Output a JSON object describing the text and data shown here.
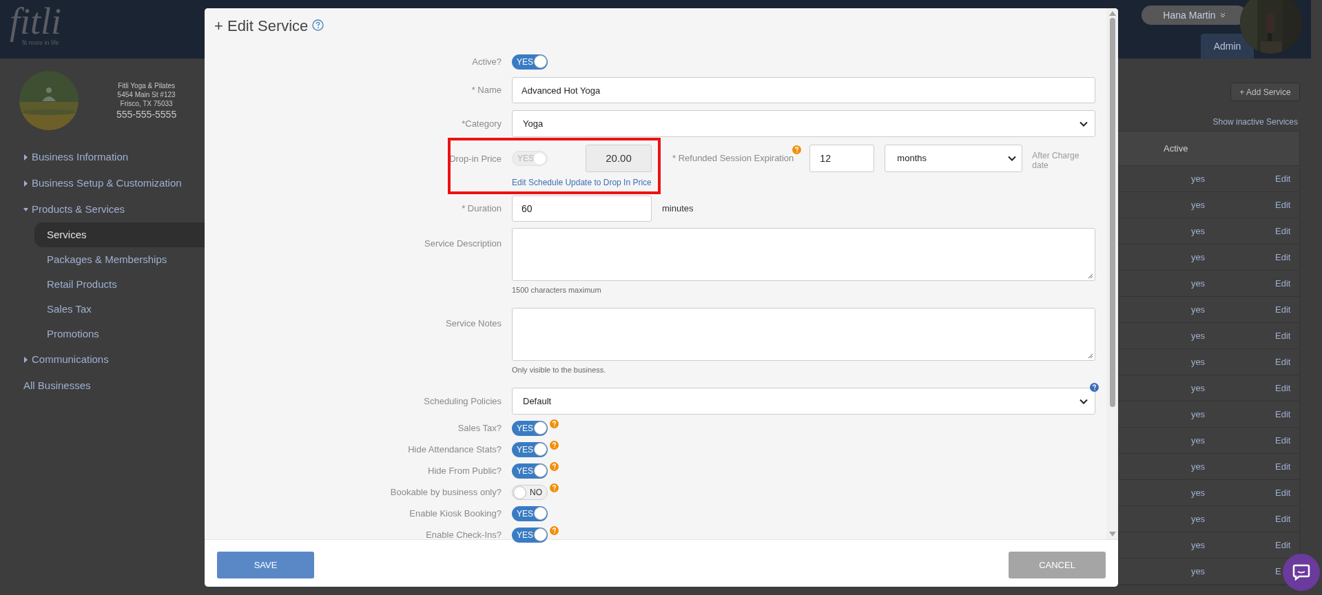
{
  "header": {
    "logo": "fitli",
    "tagline": "fit more in life",
    "user": "Hana Martin",
    "tabs": [
      {
        "label": "Admin",
        "selected": true
      }
    ]
  },
  "business": {
    "name": "Fitli Yoga & Pilates",
    "address": "5454 Main St #123",
    "city": "Frisco, TX 75033",
    "phone": "555-555-5555"
  },
  "sidebar": {
    "items": [
      {
        "kind": "group",
        "label": "Business Information",
        "expanded": false
      },
      {
        "kind": "group",
        "label": "Business Setup & Customization",
        "expanded": false
      },
      {
        "kind": "group",
        "label": "Products & Services",
        "expanded": true,
        "children": [
          {
            "label": "Services",
            "selected": true
          },
          {
            "label": "Packages & Memberships",
            "selected": false
          },
          {
            "label": "Retail Products",
            "selected": false
          },
          {
            "label": "Sales Tax",
            "selected": false
          },
          {
            "label": "Promotions",
            "selected": false
          }
        ]
      },
      {
        "kind": "group",
        "label": "Communications",
        "expanded": false
      },
      {
        "kind": "link",
        "label": "All Businesses"
      }
    ]
  },
  "page": {
    "add_button": "+ Add Service",
    "show_inactive": "Show inactive Services",
    "table": {
      "columns": [
        "Active"
      ],
      "rows": [
        {
          "active": "yes",
          "action": "Edit"
        },
        {
          "active": "yes",
          "action": "Edit"
        },
        {
          "active": "yes",
          "action": "Edit"
        },
        {
          "active": "yes",
          "action": "Edit"
        },
        {
          "active": "yes",
          "action": "Edit"
        },
        {
          "active": "yes",
          "action": "Edit"
        },
        {
          "active": "yes",
          "action": "Edit"
        },
        {
          "active": "yes",
          "action": "Edit"
        },
        {
          "active": "yes",
          "action": "Edit"
        },
        {
          "active": "yes",
          "action": "Edit"
        },
        {
          "active": "yes",
          "action": "Edit"
        },
        {
          "active": "yes",
          "action": "Edit"
        },
        {
          "active": "yes",
          "action": "Edit"
        },
        {
          "active": "yes",
          "action": "Edit"
        },
        {
          "active": "yes",
          "action": "Edit"
        },
        {
          "active": "yes",
          "action": "E"
        }
      ]
    }
  },
  "modal": {
    "title": "+ Edit Service",
    "fields": [
      {
        "kind": "toggle",
        "label": "Active?",
        "on": true,
        "text": "YES",
        "help": false
      },
      {
        "kind": "text",
        "label": "* Name",
        "value": "Advanced Hot Yoga"
      },
      {
        "kind": "select",
        "label": "*Category",
        "value": "Yoga",
        "help": false
      },
      {
        "kind": "drop_in",
        "label": "Drop-in Price",
        "highlighted": true,
        "toggle": {
          "on": true,
          "disabled": true,
          "text": "YES"
        },
        "price": "20.00",
        "link": "Edit Schedule Update to Drop In Price",
        "expiration": {
          "label": "* Refunded Session Expiration",
          "value": "12",
          "unit": "months",
          "note": "After Charge date"
        }
      },
      {
        "kind": "duration",
        "label": "* Duration",
        "value": "60",
        "unit": "minutes"
      },
      {
        "kind": "textarea",
        "label": "Service Description",
        "hint": "1500 characters maximum"
      },
      {
        "kind": "textarea",
        "label": "Service Notes",
        "hint": "Only visible to the business."
      },
      {
        "kind": "select",
        "label": "Scheduling Policies",
        "value": "Default",
        "help": true
      },
      {
        "kind": "toggle",
        "label": "Sales Tax?",
        "on": true,
        "text": "YES",
        "help": true
      },
      {
        "kind": "toggle",
        "label": "Hide Attendance Stats?",
        "on": true,
        "text": "YES",
        "help": true
      },
      {
        "kind": "toggle",
        "label": "Hide From Public?",
        "on": true,
        "text": "YES",
        "help": true
      },
      {
        "kind": "toggle",
        "label": "Bookable by business only?",
        "on": false,
        "text": "NO",
        "help": true
      },
      {
        "kind": "toggle",
        "label": "Enable Kiosk Booking?",
        "on": true,
        "text": "YES",
        "help": false
      },
      {
        "kind": "toggle",
        "label": "Enable Check-Ins?",
        "on": true,
        "text": "YES",
        "help": true
      }
    ],
    "save": "SAVE",
    "cancel": "CANCEL"
  }
}
